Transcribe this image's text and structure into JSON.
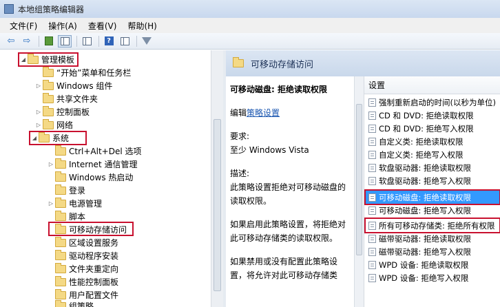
{
  "window": {
    "title": "本地组策略编辑器"
  },
  "menu": [
    "文件(F)",
    "操作(A)",
    "查看(V)",
    "帮助(H)"
  ],
  "toolbar": {
    "back": "⇦",
    "forward": "⇨"
  },
  "tree": {
    "items": [
      {
        "label": "管理模板",
        "arrow": "◢"
      },
      {
        "label": "“开始”菜单和任务栏",
        "arrow": ""
      },
      {
        "label": "Windows 组件",
        "arrow": "▷"
      },
      {
        "label": "共享文件夹",
        "arrow": ""
      },
      {
        "label": "控制面板",
        "arrow": "▷"
      },
      {
        "label": "网络",
        "arrow": "▷"
      },
      {
        "label": "系统",
        "arrow": "◢"
      },
      {
        "label": "Ctrl+Alt+Del 选项",
        "arrow": ""
      },
      {
        "label": "Internet 通信管理",
        "arrow": "▷"
      },
      {
        "label": "Windows 热启动",
        "arrow": ""
      },
      {
        "label": "登录",
        "arrow": ""
      },
      {
        "label": "电源管理",
        "arrow": "▷"
      },
      {
        "label": "脚本",
        "arrow": ""
      },
      {
        "label": "可移动存储访问",
        "arrow": ""
      },
      {
        "label": "区域设置服务",
        "arrow": ""
      },
      {
        "label": "驱动程序安装",
        "arrow": ""
      },
      {
        "label": "文件夹重定向",
        "arrow": ""
      },
      {
        "label": "性能控制面板",
        "arrow": ""
      },
      {
        "label": "用户配置文件",
        "arrow": ""
      },
      {
        "label": "组策略",
        "arrow": ""
      }
    ]
  },
  "right": {
    "header": "可移动存储访问",
    "detail": {
      "title": "可移动磁盘: 拒绝读取权限",
      "edit_prefix": "编辑",
      "edit_link": "策略设置",
      "req_label": "要求:",
      "req_value": "至少 Windows Vista",
      "desc_label": "描述:",
      "desc1": "此策略设置拒绝对可移动磁盘的读取权限。",
      "desc2": "如果启用此策略设置，将拒绝对此可移动存储类的读取权限。",
      "desc3": "如果禁用或没有配置此策略设置，将允许对此可移动存储类"
    },
    "settings_header": "设置",
    "settings": [
      "强制重新启动的时间(以秒为单位)",
      "CD 和 DVD: 拒绝读取权限",
      "CD 和 DVD: 拒绝写入权限",
      "自定义类: 拒绝读取权限",
      "自定义类: 拒绝写入权限",
      "软盘驱动器: 拒绝读取权限",
      "软盘驱动器: 拒绝写入权限",
      "可移动磁盘: 拒绝读取权限",
      "可移动磁盘: 拒绝写入权限",
      "所有可移动存储类: 拒绝所有权限",
      "磁带驱动器: 拒绝读取权限",
      "磁带驱动器: 拒绝写入权限",
      "WPD 设备: 拒绝读取权限",
      "WPD 设备: 拒绝写入权限"
    ],
    "selected_index": 7
  }
}
